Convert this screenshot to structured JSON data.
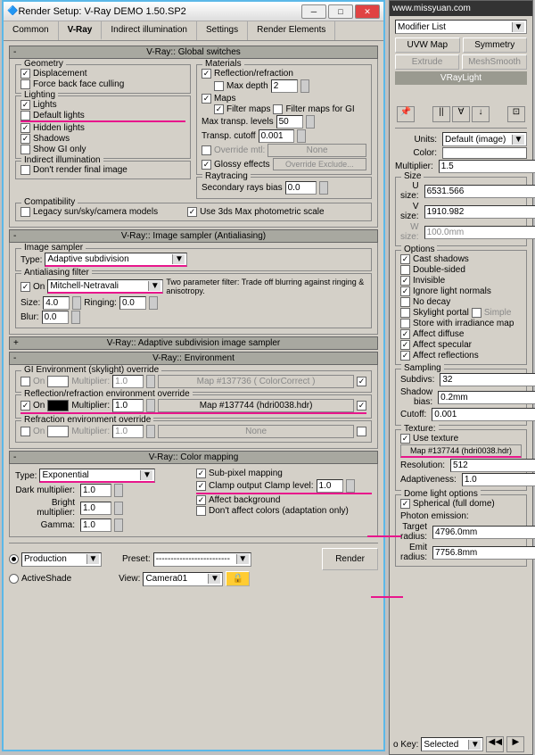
{
  "window": {
    "title": "Render Setup: V-Ray DEMO 1.50.SP2"
  },
  "tabs": {
    "t1": "Common",
    "t2": "V-Ray",
    "t3": "Indirect illumination",
    "t4": "Settings",
    "t5": "Render Elements"
  },
  "gs": {
    "hdr": "V-Ray:: Global switches",
    "geom": {
      "lbl": "Geometry",
      "disp": "Displacement",
      "back": "Force back face culling"
    },
    "light": {
      "lbl": "Lighting",
      "lights": "Lights",
      "def": "Default lights",
      "hid": "Hidden lights",
      "shad": "Shadows",
      "gi": "Show GI only"
    },
    "mat": {
      "lbl": "Materials",
      "refl": "Reflection/refraction",
      "maxd": "Max depth",
      "maxdv": "2",
      "maps": "Maps",
      "fmap": "Filter maps",
      "fmapgi": "Filter maps for GI",
      "mtl": "Max transp. levels",
      "mtlv": "50",
      "tc": "Transp. cutoff",
      "tcv": "0.001",
      "ovr": "Override mtl:",
      "ovrbtn": "None",
      "gloss": "Glossy effects",
      "ovrex": "Override Exclude..."
    },
    "ii": {
      "lbl": "Indirect illumination",
      "dont": "Don't render final image"
    },
    "ray": {
      "lbl": "Raytracing",
      "sec": "Secondary rays bias",
      "secv": "0.0"
    },
    "comp": {
      "lbl": "Compatibility",
      "leg": "Legacy sun/sky/camera models",
      "u3": "Use 3ds Max photometric scale"
    }
  },
  "is": {
    "hdr": "V-Ray:: Image sampler (Antialiasing)",
    "samp": {
      "lbl": "Image sampler",
      "type": "Type:",
      "typev": "Adaptive subdivision"
    },
    "aa": {
      "lbl": "Antialiasing filter",
      "on": "On",
      "filt": "Mitchell-Netravali",
      "desc": "Two parameter filter: Trade off blurring against ringing & anisotropy.",
      "size": "Size:",
      "sizev": "4.0",
      "ring": "Ringing:",
      "ringv": "0.0",
      "blur": "Blur:",
      "blurv": "0.0"
    }
  },
  "asis": {
    "hdr": "V-Ray:: Adaptive subdivision image sampler"
  },
  "env": {
    "hdr": "V-Ray:: Environment",
    "gi": {
      "lbl": "GI Environment (skylight) override",
      "on": "On",
      "mult": "Multiplier:",
      "multv": "1.0",
      "map": "Map #137736  ( ColorCorrect )"
    },
    "rr": {
      "lbl": "Reflection/refraction environment override",
      "on": "On",
      "mult": "Multiplier:",
      "multv": "1.0",
      "map": "Map #137744 (hdri0038.hdr)"
    },
    "rf": {
      "lbl": "Refraction environment override",
      "on": "On",
      "mult": "Multiplier:",
      "multv": "1.0",
      "map": "None"
    }
  },
  "cm": {
    "hdr": "V-Ray:: Color mapping",
    "type": "Type:",
    "typev": "Exponential",
    "dm": "Dark multiplier:",
    "dmv": "1.0",
    "bm": "Bright multiplier:",
    "bmv": "1.0",
    "gm": "Gamma:",
    "gmv": "1.0",
    "sub": "Sub-pixel mapping",
    "clamp": "Clamp output",
    "clampl": "Clamp level:",
    "clamplv": "1.0",
    "aff": "Affect background",
    "dont": "Don't affect colors (adaptation only)"
  },
  "bot": {
    "prod": "Production",
    "as": "ActiveShade",
    "preset": "Preset:",
    "presetv": "-------------------------",
    "view": "View:",
    "viewv": "Camera01",
    "render": "Render"
  },
  "right": {
    "topurl": "www.missyuan.com",
    "modl": "Modifier List",
    "uvw": "UVW Map",
    "sym": "Symmetry",
    "ext": "Extrude",
    "ms": "MeshSmooth",
    "sel": "VRayLight",
    "units": "Units:",
    "unitsv": "Default (image)",
    "color": "Color:",
    "mult": "Multiplier:",
    "multv": "1.5",
    "size": "Size",
    "us": "U size:",
    "usv": "6531.566",
    "vs": "V size:",
    "vsv": "1910.982",
    "ws": "W size:",
    "wsv": "100.0mm",
    "opt": "Options",
    "cast": "Cast shadows",
    "ds": "Double-sided",
    "inv": "Invisible",
    "ign": "Ignore light normals",
    "nd": "No decay",
    "sky": "Skylight portal",
    "simp": "Simple",
    "irr": "Store with irradiance map",
    "ad": "Affect diffuse",
    "asp": "Affect specular",
    "ar": "Affect reflections",
    "samp": "Sampling",
    "subd": "Subdivs:",
    "subdv": "32",
    "sb": "Shadow bias:",
    "sbv": "0.2mm",
    "co": "Cutoff:",
    "cov": "0.001",
    "tex": "Texture:",
    "ut": "Use texture",
    "map": "Map #137744 (hdri0038.hdr)",
    "res": "Resolution:",
    "resv": "512",
    "adap": "Adaptiveness:",
    "adapv": "1.0",
    "dome": "Dome light options",
    "sph": "Spherical (full dome)",
    "pe": "Photon emission:",
    "tr": "Target radius:",
    "trv": "4796.0mm",
    "er": "Emit radius:",
    "erv": "7756.8mm",
    "key": "o Key:",
    "keysel": "Selected"
  }
}
